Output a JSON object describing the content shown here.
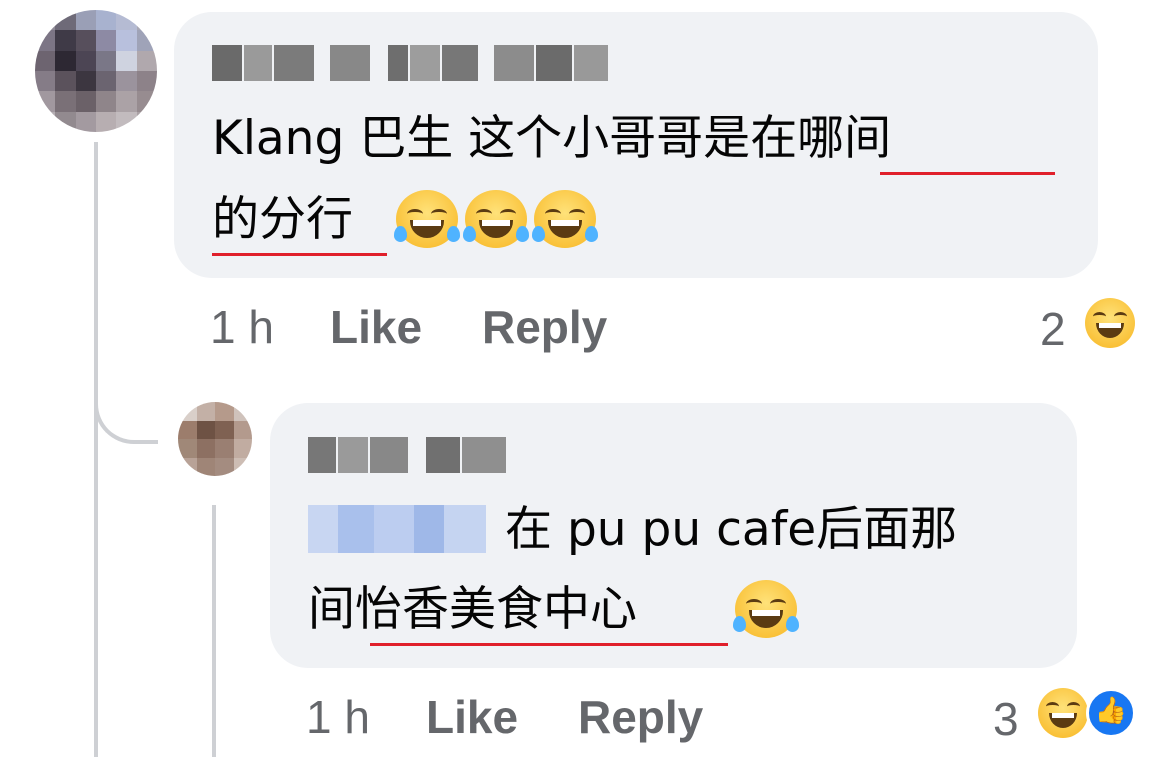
{
  "comment": {
    "text_line1_plain": "Klang 巴生 这个小哥哥是",
    "text_line1_marked": "在哪间",
    "text_line2_marked": "的分行",
    "time": "1 h",
    "like_label": "Like",
    "reply_label": "Reply",
    "reaction_count": "2",
    "reactions": [
      "haha-icon"
    ],
    "emojis": [
      "joy-emoji",
      "joy-emoji",
      "joy-emoji"
    ]
  },
  "reply": {
    "text_line1": "在 pu pu cafe后面那",
    "text_line2_plain": "间",
    "text_line2_marked": "怡香美食中心",
    "time": "1 h",
    "like_label": "Like",
    "reply_label": "Reply",
    "reaction_count": "3",
    "reactions": [
      "haha-icon",
      "like-icon"
    ],
    "emojis": [
      "joy-emoji"
    ]
  },
  "colors": {
    "bubble": "#f0f2f5",
    "meta_text": "#65676b",
    "underline": "#e0202b",
    "like_blue": "#1877f2"
  }
}
